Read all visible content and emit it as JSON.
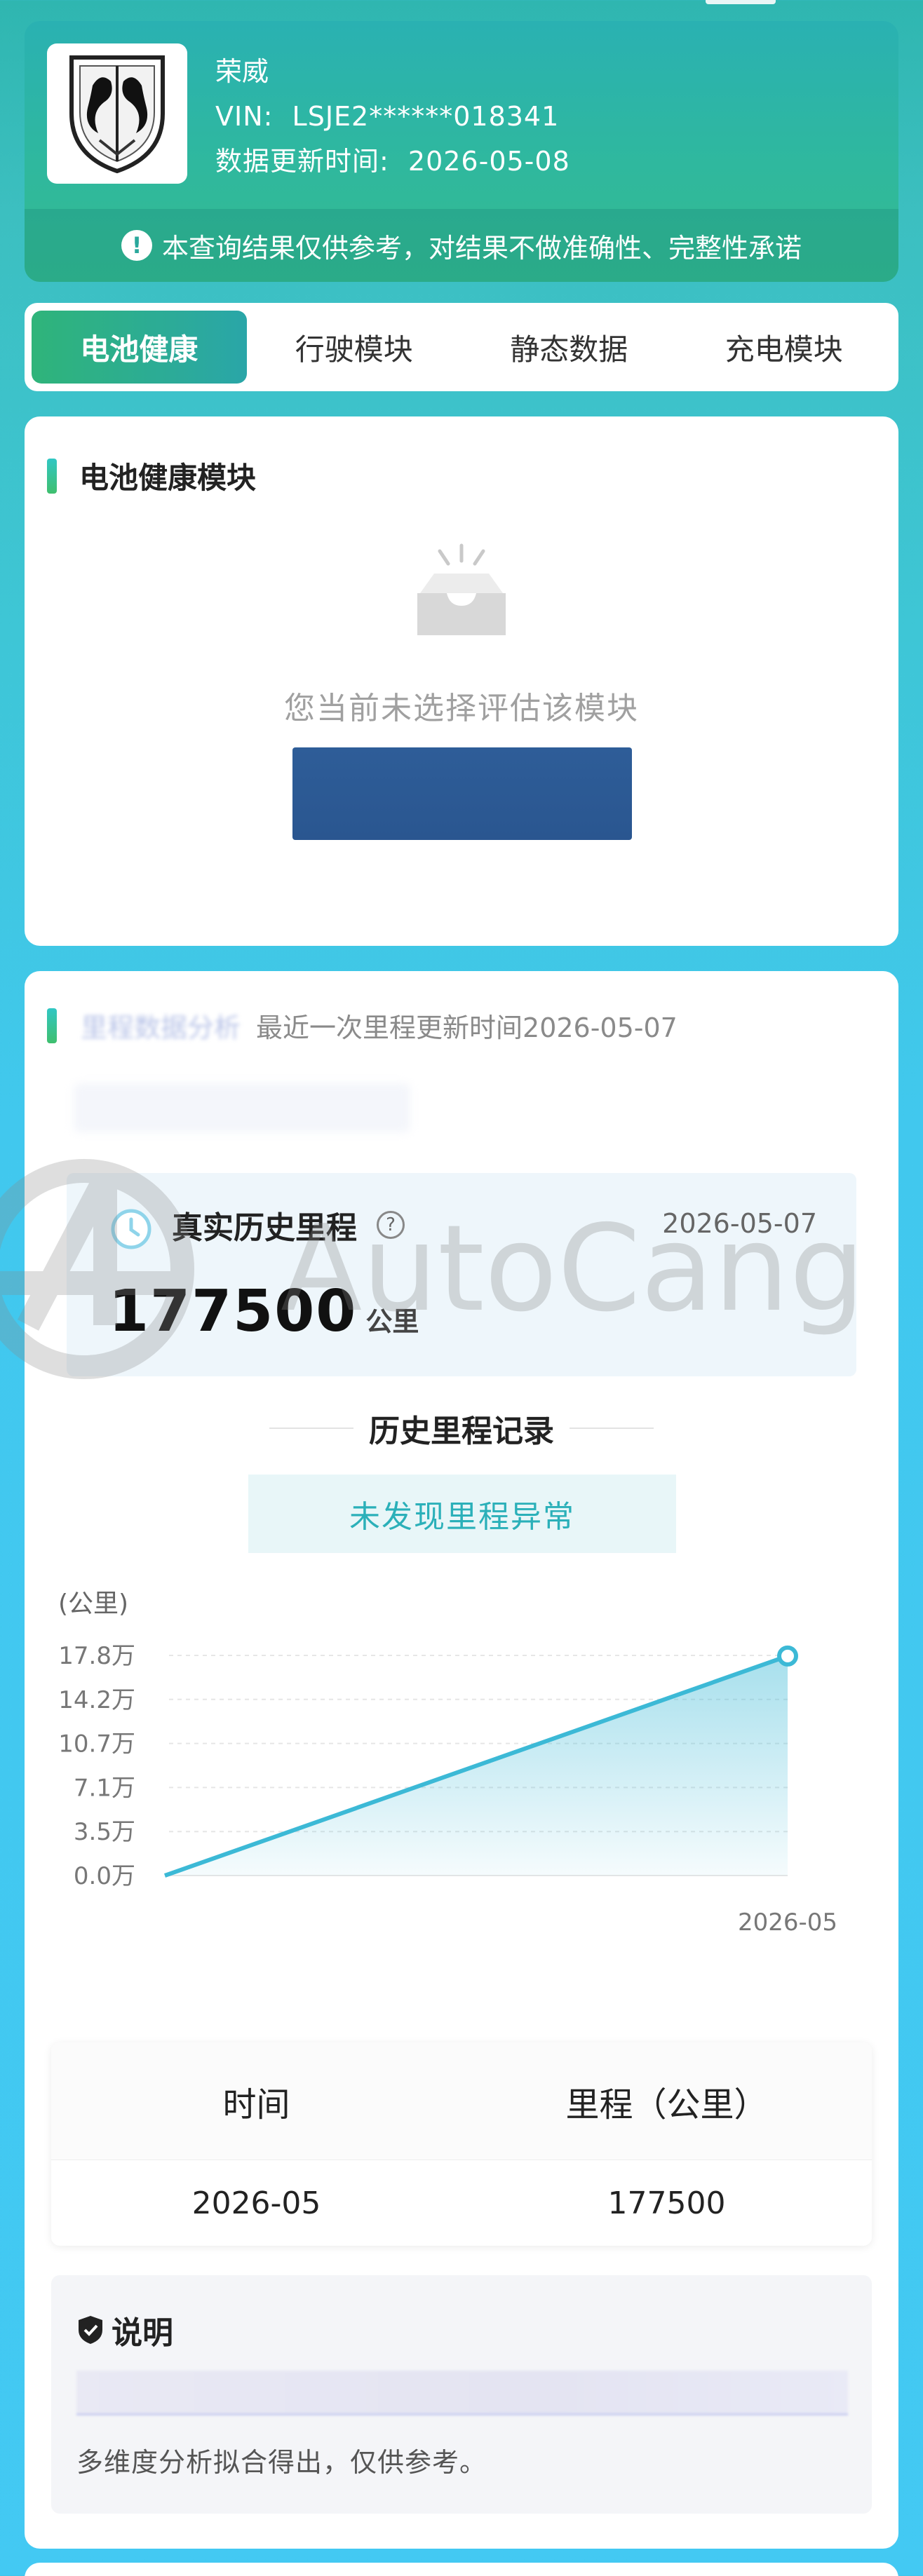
{
  "vehicle": {
    "brand": "荣威",
    "vin_label": "VIN:",
    "vin": "LSJE2******018341",
    "update_label": "数据更新时间:",
    "update_date": "2026-05-08"
  },
  "notice": "本查询结果仅供参考，对结果不做准确性、完整性承诺",
  "tabs": [
    {
      "label": "电池健康",
      "active": true
    },
    {
      "label": "行驶模块",
      "active": false
    },
    {
      "label": "静态数据",
      "active": false
    },
    {
      "label": "充电模块",
      "active": false
    }
  ],
  "battery": {
    "title": "电池健康模块",
    "empty_text": "您当前未选择评估该模块",
    "empty_icon": "empty-tray-icon"
  },
  "mileage": {
    "header_blurred": "里程数据分析",
    "last_update": "最近一次里程更新时间2026-05-07",
    "real_label": "真实历史里程",
    "real_date": "2026-05-07",
    "value": "177500",
    "unit": "公里",
    "record_title": "历史里程记录",
    "anomaly": "未发现里程异常"
  },
  "chart_data": {
    "type": "area",
    "ylabel": "(公里)",
    "y_ticks": [
      "0.0万",
      "3.5万",
      "7.1万",
      "10.7万",
      "14.2万",
      "17.8万"
    ],
    "ylim": [
      0,
      178000
    ],
    "x": [
      "",
      "2026-05"
    ],
    "values": [
      0,
      177500
    ],
    "x_tick_labels": [
      "2026-05"
    ],
    "grid": true,
    "color": "#3cb9d6"
  },
  "table": {
    "headers": [
      "时间",
      "里程（公里）"
    ],
    "rows": [
      [
        "2026-05",
        "177500"
      ]
    ]
  },
  "note": {
    "title": "说明",
    "text": "多维度分析拟合得出，仅供参考。"
  },
  "watermark": "AutoCang"
}
